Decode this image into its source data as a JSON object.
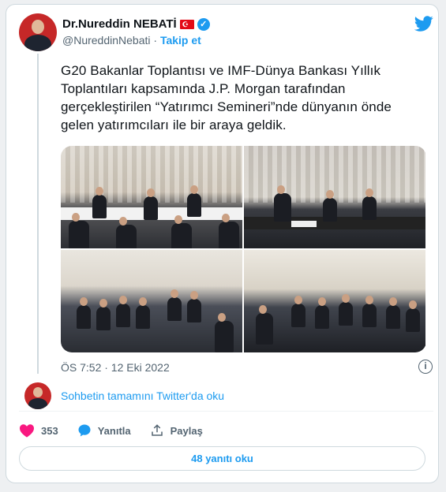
{
  "tweet": {
    "author_name": "Dr.Nureddin NEBATİ",
    "flag_symbol": "☪",
    "handle": "@NureddinNebati",
    "separator": "·",
    "follow_label": "Takip et",
    "text": "G20 Bakanlar Toplantısı ve IMF-Dünya Bankası Yıllık Toplantıları kapsamında J.P. Morgan tarafından gerçekleştirilen “Yatırımcı Semineri”nde dünyanın önde gelen yatırımcıları ile bir araya geldik.",
    "timestamp": "ÖS 7:52 · 12 Eki 2022",
    "info_symbol": "i",
    "conversation_link": "Sohbetin tamamını Twitter'da oku",
    "likes": "353",
    "reply_label": "Yanıtla",
    "share_label": "Paylaş",
    "read_replies_label": "48 yanıtı oku"
  },
  "colors": {
    "twitter_blue": "#1d9bf0",
    "like_pink": "#f91880",
    "muted_text": "#536471",
    "flag_red": "#e30a17"
  },
  "icons": [
    "twitter-bird-icon",
    "verified-badge-icon",
    "info-icon",
    "heart-icon",
    "reply-bubble-icon",
    "share-icon"
  ]
}
